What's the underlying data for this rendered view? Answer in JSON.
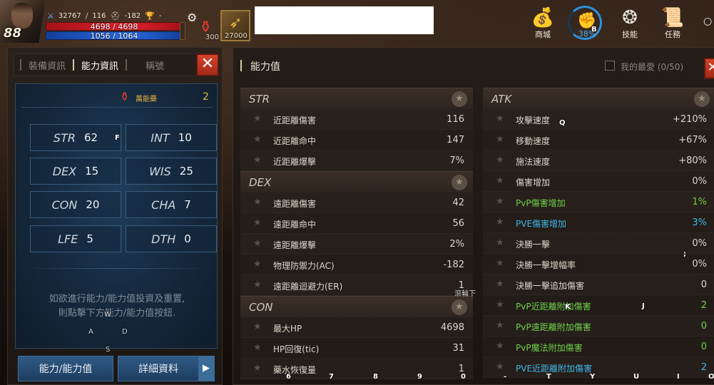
{
  "hud": {
    "level": "88",
    "combat_power": "32767",
    "sword_stat": "116",
    "helmet_stat": "-182",
    "trophy_text": "-",
    "hp": "4698 / 4698",
    "mp": "1056 / 1064",
    "potion_count": "300",
    "buff_count": "27000",
    "menu": [
      {
        "label": "商城",
        "icon": "money-bag-icon"
      },
      {
        "label": "38%",
        "icon": "fist-icon"
      },
      {
        "label": "技能",
        "icon": "skill-icon"
      },
      {
        "label": "任務",
        "icon": "scroll-icon"
      }
    ],
    "accent_hp": "#e0202a",
    "accent_mp": "#2a6ae0"
  },
  "left": {
    "tabs": [
      "裝備資訊",
      "能力資訊",
      "稱號"
    ],
    "elixir_name": "萬能藥",
    "elixir_count": "2",
    "stats": [
      {
        "key": "STR",
        "value": "62"
      },
      {
        "key": "INT",
        "value": "10"
      },
      {
        "key": "DEX",
        "value": "15"
      },
      {
        "key": "WIS",
        "value": "25"
      },
      {
        "key": "CON",
        "value": "20"
      },
      {
        "key": "CHA",
        "value": "7"
      },
      {
        "key": "LFE",
        "value": "5"
      },
      {
        "key": "DTH",
        "value": "0"
      }
    ],
    "hint_line1": "如欲進行能力/能力值投資及重置,",
    "hint_line2": "則點擊下方能力/能力值按鈕.",
    "button_ability": "能力/能力值",
    "button_detail": "詳細資料"
  },
  "right": {
    "title": "能力值",
    "favorite_label": "我的最愛 (0/50)",
    "sections_left": [
      {
        "name": "STR",
        "rows": [
          {
            "label": "近距離傷害",
            "value": "116"
          },
          {
            "label": "近距離命中",
            "value": "147"
          },
          {
            "label": "近距離爆擊",
            "value": "7%"
          }
        ]
      },
      {
        "name": "DEX",
        "rows": [
          {
            "label": "遠距離傷害",
            "value": "42"
          },
          {
            "label": "遠距離命中",
            "value": "56"
          },
          {
            "label": "遠距離爆擊",
            "value": "2%"
          },
          {
            "label": "物理防禦力(AC)",
            "value": "-182"
          },
          {
            "label": "遠距離迴避力(ER)",
            "value": "1"
          }
        ]
      },
      {
        "name": "CON",
        "rows": [
          {
            "label": "最大HP",
            "value": "4698"
          },
          {
            "label": "HP回復(tic)",
            "value": "31"
          },
          {
            "label": "藥水恢復量",
            "value": "1"
          }
        ]
      }
    ],
    "section_right": {
      "name": "ATK",
      "rows": [
        {
          "label": "攻擊速度",
          "value": "+210%",
          "color": ""
        },
        {
          "label": "移動速度",
          "value": "+67%",
          "color": ""
        },
        {
          "label": "施法速度",
          "value": "+80%",
          "color": ""
        },
        {
          "label": "傷害增加",
          "value": "0%",
          "color": ""
        },
        {
          "label": "PvP傷害增加",
          "value": "1%",
          "color": "green"
        },
        {
          "label": "PVE傷害增加",
          "value": "3%",
          "color": "cyan"
        },
        {
          "label": "決勝一擊",
          "value": "0%",
          "color": ""
        },
        {
          "label": "決勝一擊增幅率",
          "value": "0%",
          "color": ""
        },
        {
          "label": "決勝一擊追加傷害",
          "value": "0",
          "color": ""
        },
        {
          "label": "PvP近距離附加傷害",
          "value": "2",
          "color": "green"
        },
        {
          "label": "PvP遠距離附加傷害",
          "value": "0",
          "color": "green"
        },
        {
          "label": "PvP魔法附加傷害",
          "value": "0",
          "color": "green"
        },
        {
          "label": "PVE近距離附加傷害",
          "value": "2",
          "color": "cyan"
        }
      ]
    }
  },
  "key_hints": {
    "F": "F",
    "Q": "Q",
    "B": "B",
    "W": "W",
    "A": "A",
    "D": "D",
    "S": "S",
    "K": "K",
    "J": "J",
    "colon": ";",
    "scroll": "滾輪下",
    "n6": "6",
    "n7": "7",
    "n8": "8",
    "n9": "9",
    "n0": "0",
    "minus": "-",
    "T": "T",
    "Y": "Y",
    "U": "U",
    "I": "I",
    "O": "O"
  }
}
